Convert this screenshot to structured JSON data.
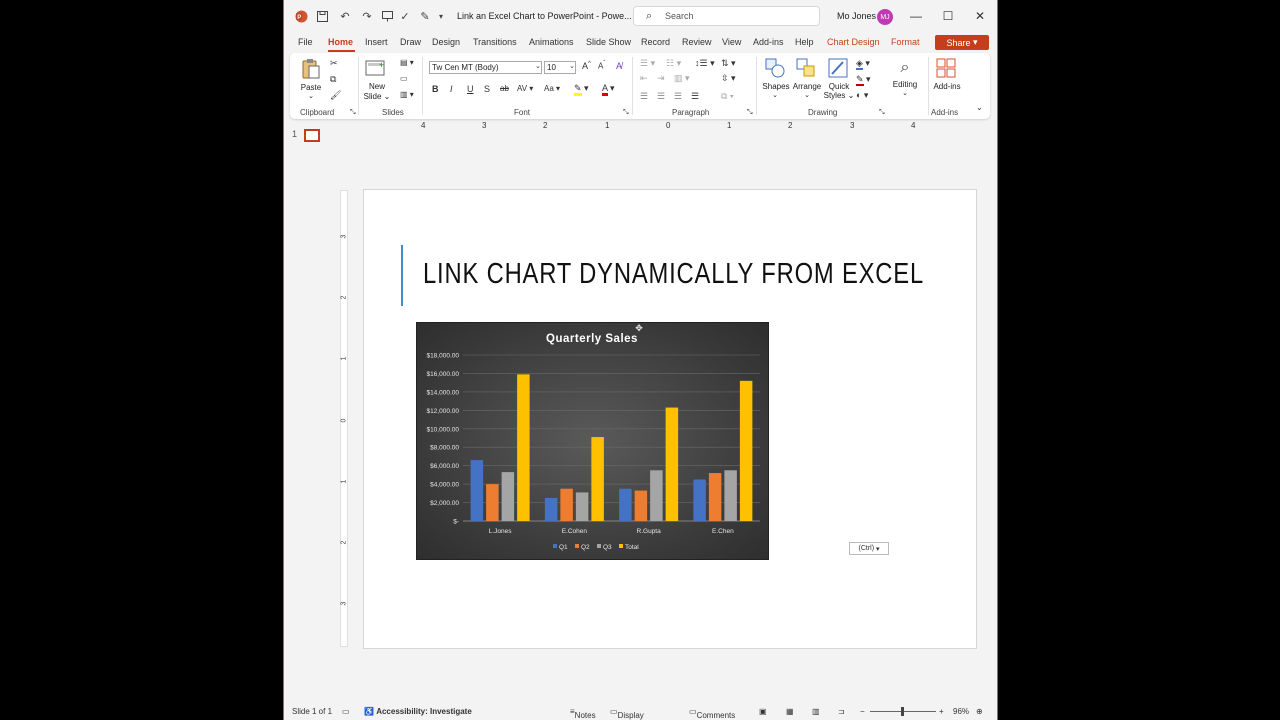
{
  "titlebar": {
    "document_title": "Link an Excel Chart to PowerPoint  -  Powe...",
    "search_placeholder": "Search",
    "user_name": "Mo Jones",
    "user_initials": "MJ"
  },
  "tabs": [
    "File",
    "Home",
    "Insert",
    "Draw",
    "Design",
    "Transitions",
    "Animations",
    "Slide Show",
    "Record",
    "Review",
    "View",
    "Add-ins",
    "Help",
    "Chart Design",
    "Format"
  ],
  "share_label": "Share",
  "ribbon": {
    "paste": "Paste",
    "new_slide": "New",
    "new_slide2": "Slide",
    "font_name": "Tw Cen MT (Body)",
    "font_size": "10",
    "shapes": "Shapes",
    "arrange": "Arrange",
    "quick_styles": "Quick",
    "quick_styles2": "Styles",
    "editing": "Editing",
    "addins": "Add-ins",
    "groups": {
      "clipboard": "Clipboard",
      "slides": "Slides",
      "font": "Font",
      "paragraph": "Paragraph",
      "drawing": "Drawing",
      "addins": "Add-ins"
    }
  },
  "ruler_h": [
    "4",
    "3",
    "2",
    "1",
    "0",
    "1",
    "2",
    "3",
    "4"
  ],
  "ruler_v": [
    "3",
    "2",
    "1",
    "0",
    "1",
    "2",
    "3"
  ],
  "thumbnail_number": "1",
  "slide": {
    "title": "LINK CHART DYNAMICALLY FROM EXCEL"
  },
  "paste_options": "(Ctrl)",
  "chart_data": {
    "type": "bar",
    "title": "Quarterly Sales",
    "categories": [
      "L.Jones",
      "E.Cohen",
      "R.Gupta",
      "E.Chen"
    ],
    "series": [
      {
        "name": "Q1",
        "values": [
          6600,
          2500,
          3500,
          4500
        ],
        "color": "#4472c4"
      },
      {
        "name": "Q2",
        "values": [
          4000,
          3500,
          3300,
          5200
        ],
        "color": "#ed7d31"
      },
      {
        "name": "Q3",
        "values": [
          5300,
          3100,
          5500,
          5500
        ],
        "color": "#a5a5a5"
      },
      {
        "name": "Total",
        "values": [
          15900,
          9100,
          12300,
          15200
        ],
        "color": "#ffc000"
      }
    ],
    "ylim": [
      0,
      18000
    ],
    "yticks": [
      "$-",
      "$2,000.00",
      "$4,000.00",
      "$6,000.00",
      "$8,000.00",
      "$10,000.00",
      "$12,000.00",
      "$14,000.00",
      "$16,000.00",
      "$18,000.00"
    ],
    "legend": "bottom",
    "grid": true
  },
  "status": {
    "slide": "Slide 1 of 1",
    "accessibility": "Accessibility: Investigate",
    "notes": "Notes",
    "display_settings": "Display Settings",
    "comments": "Comments",
    "zoom": "96%"
  }
}
